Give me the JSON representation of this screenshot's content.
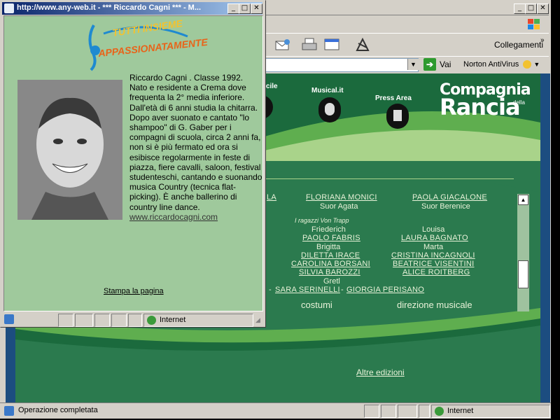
{
  "popup": {
    "title": "http://www.any-web.it - *** Riccardo Cagni *** - M...",
    "logo_line1": "TUTTI INSIEME",
    "logo_line2": "APPASSIONATAMENTE",
    "bio": "Riccardo Cagni . Classe 1992. Nato e residente a Crema dove frequenta la 2° media inferiore. Dall'età di 6 anni studia la chitarra. Dopo aver suonato e cantato \"lo shampoo\" di G. Gaber per i compagni di scuola, circa 2 anni fa, non si è più fermato ed ora si esibisce regolarmente in feste di piazza, fiere cavalli, saloon, festival studenteschi, cantando e suonando musica Country (tecnica flat-picking). È anche ballerino di country line dance.",
    "website": "www.riccardocagni.com",
    "print_link": "Stampa la pagina",
    "status_zone": "Internet"
  },
  "browser": {
    "links_label": "Collegamenti",
    "go_label": "Vai",
    "norton_label": "Norton AntiVirus",
    "status_text": "Operazione completata",
    "status_zone": "Internet"
  },
  "site": {
    "nav": [
      {
        "label": "facile"
      },
      {
        "label": "Musical.it"
      },
      {
        "label": "Press Area"
      }
    ],
    "logo_main_top": "Compagnia",
    "logo_small": "della",
    "logo_main_bottom": "Rancia",
    "cast": {
      "row1_partial": "LA",
      "row1_a": "FLORIANA MONICI",
      "row1_b": "PAOLA GIACALONE",
      "role1_a": "Suor Agata",
      "role1_b": "Suor Berenice",
      "note": "I ragazzi Von Trapp",
      "role2_a": "Friederich",
      "role2_b": "Louisa",
      "row2_a": "PAOLO FABRIS",
      "row2_b": "LAURA BAGNATO",
      "role3_a": "Brigitta",
      "role3_b": "Marta",
      "row3_a": "DILETTA IRACE",
      "row3_b": "CRISTINA INCAGNOLI",
      "row4_a": "CAROLINA BORSANI",
      "row4_b": "BEATRICE VISENTINI",
      "row5_a": "SILVIA BAROZZI",
      "row5_b": "ALICE ROITBERG",
      "role4_a": "Gretl",
      "sep1": "-",
      "row6_a": "SARA SERINELLI",
      "sep2": "-",
      "row6_b": "GIORGIA PERISANO",
      "costumes": "costumi",
      "music_direction": "direzione musicale"
    },
    "other_editions": "Altre edizioni"
  },
  "colors": {
    "site_green": "#2b7a4e",
    "popup_bg": "#9fc99c",
    "title_bar": "#0a246a"
  }
}
